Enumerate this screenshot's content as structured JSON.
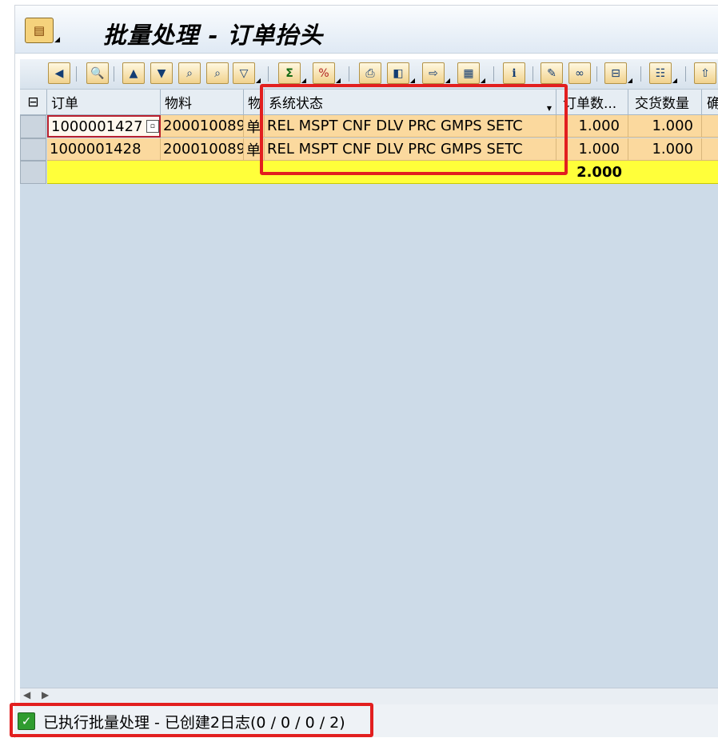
{
  "window": {
    "title": "批量处理 - 订单抬头"
  },
  "toolbar": {
    "buttons": [
      {
        "icon": "back-arrow-icon",
        "glyph": "◀"
      },
      {
        "icon": "details-icon",
        "glyph": "🔍"
      },
      {
        "icon": "sort-ascending-icon",
        "glyph": "▲"
      },
      {
        "icon": "sort-descending-icon",
        "glyph": "▼"
      },
      {
        "icon": "find-icon",
        "glyph": "⌕"
      },
      {
        "icon": "find-next-icon",
        "glyph": "⌕"
      },
      {
        "icon": "filter-icon",
        "glyph": "▽"
      },
      {
        "icon": "sum-icon",
        "glyph": "Σ"
      },
      {
        "icon": "subtotal-icon",
        "glyph": "%"
      },
      {
        "icon": "print-icon",
        "glyph": "⎙"
      },
      {
        "icon": "view-icon",
        "glyph": "◧"
      },
      {
        "icon": "export-icon",
        "glyph": "⇨"
      },
      {
        "icon": "layout-icon",
        "glyph": "▦"
      },
      {
        "icon": "info-icon",
        "glyph": "i"
      },
      {
        "icon": "edit-pencil-icon",
        "glyph": "✎"
      },
      {
        "icon": "display-glasses-icon",
        "glyph": "∞"
      },
      {
        "icon": "hierarchy-icon",
        "glyph": "⊟"
      },
      {
        "icon": "column-settings-icon",
        "glyph": "☷"
      },
      {
        "icon": "more-icon",
        "glyph": "⇧"
      }
    ]
  },
  "table": {
    "columns": [
      "订单",
      "物料",
      "物",
      "系统状态",
      "订单数...",
      "交货数量",
      "确"
    ],
    "rows": [
      {
        "order": "1000001427",
        "material": "200010089",
        "desc": "单",
        "status": "REL  MSPT CNF  DLV  PRC  GMPS SETC",
        "order_qty": "1.000",
        "delivered_qty": "1.000"
      },
      {
        "order": "1000001428",
        "material": "200010089",
        "desc": "单",
        "status": "REL  MSPT CNF  DLV  PRC  GMPS SETC",
        "order_qty": "1.000",
        "delivered_qty": "1.000"
      }
    ],
    "total_order_qty": "2.000"
  },
  "status": {
    "message": "已执行批量处理 - 已创建2日志(0 / 0 / 0 / 2)"
  },
  "colors": {
    "row_bg": "#fbd99e",
    "total_bg": "#ffff3a",
    "highlight": "#e21f1f",
    "grid_bg": "#cddbe8"
  }
}
